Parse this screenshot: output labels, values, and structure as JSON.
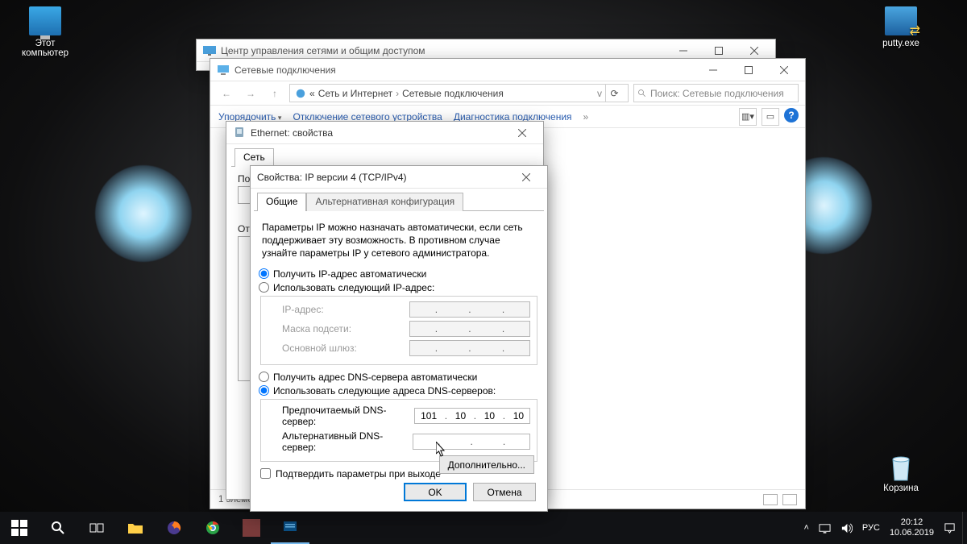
{
  "desktop": {
    "my_computer": "Этот\nкомпьютер",
    "putty": "putty.exe",
    "recycle": "Корзина"
  },
  "w1": {
    "title": "Центр управления сетями и общим доступом"
  },
  "w2": {
    "title": "Сетевые подключения",
    "crumb1": "Сеть и Интернет",
    "crumb2": "Сетевые подключения",
    "search_placeholder": "Поиск: Сетевые подключения",
    "tool_org": "Упорядочить",
    "tool_disable": "Отключение сетевого устройства",
    "tool_diag": "Диагностика подключения",
    "status": "1 элемент"
  },
  "w3": {
    "title": "Ethernet: свойства",
    "tab_net": "Сеть",
    "connect_via": "Подключение через:",
    "uses_label": "Отмеченные компоненты используются этим подключением:"
  },
  "w4": {
    "title": "Свойства: IP версии 4 (TCP/IPv4)",
    "tab_general": "Общие",
    "tab_alt": "Альтернативная конфигурация",
    "desc": "Параметры IP можно назначать автоматически, если сеть поддерживает эту возможность. В противном случае узнайте параметры IP у сетевого администратора.",
    "r_ip_auto": "Получить IP-адрес автоматически",
    "r_ip_manual": "Использовать следующий IP-адрес:",
    "f_ip": "IP-адрес:",
    "f_mask": "Маска подсети:",
    "f_gw": "Основной шлюз:",
    "r_dns_auto": "Получить адрес DNS-сервера автоматически",
    "r_dns_manual": "Использовать следующие адреса DNS-серверов:",
    "f_dns1": "Предпочитаемый DNS-сервер:",
    "f_dns2": "Альтернативный DNS-сервер:",
    "dns1_value": [
      "101",
      "10",
      "10",
      "10"
    ],
    "dns2_value": [
      "",
      "",
      "",
      ""
    ],
    "validate": "Подтвердить параметры при выходе",
    "advanced": "Дополнительно...",
    "ok": "OK",
    "cancel": "Отмена"
  },
  "tray": {
    "lang": "РУС",
    "time": "20:12",
    "date": "10.06.2019"
  }
}
